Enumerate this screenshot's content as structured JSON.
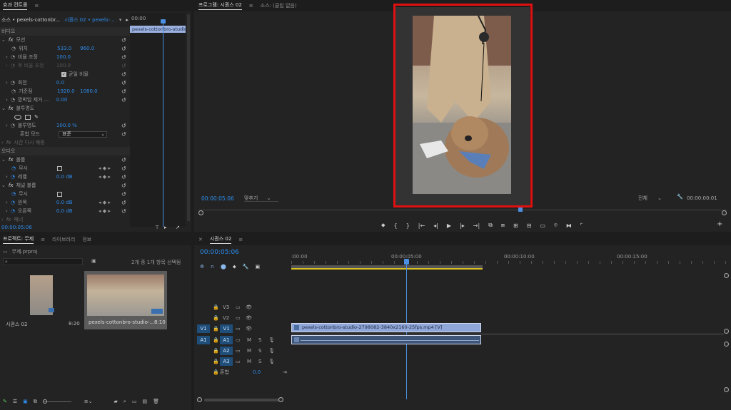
{
  "effect_controls": {
    "tab_label": "효과 컨트롤",
    "source_label": "소스 • pexels-cottonbr...",
    "sequence_label": "시퀀스 02 • pexels-...",
    "mini_time": "00:00",
    "mini_clip_label": "pexels-cottonbro-studio",
    "video_header": "비디오",
    "motion": "모션",
    "position": "위치",
    "position_x": "533.0",
    "position_y": "960.0",
    "scale": "비율 조정",
    "scale_val": "100.0",
    "scale_width": "폭 비율 조정",
    "scale_width_val": "100.0",
    "uniform_scale": "균일 비율",
    "rotation": "회전",
    "rotation_val": "0.0",
    "anchor": "기준점",
    "anchor_x": "1920.0",
    "anchor_y": "1080.0",
    "anti_flicker": "깜박임 제거 ...",
    "anti_flicker_val": "0.00",
    "opacity": "불투명도",
    "opacity_prop": "불투명도",
    "opacity_val": "100.0 %",
    "blend_mode": "혼합 모드",
    "blend_mode_val": "표준",
    "time_remap": "시간 다시 매핑",
    "audio_header": "오디오",
    "volume": "볼륨",
    "bypass": "무시",
    "level": "레벨",
    "level_val": "0.0 dB",
    "channel_volume": "채널 볼륨",
    "bypass2": "무시",
    "left": "왼쪽",
    "left_val": "0.0 dB",
    "right": "오른쪽",
    "right_val": "0.0 dB",
    "panner": "패너",
    "current_time": "00:00:05:06"
  },
  "program_monitor": {
    "tab_program": "프로그램: 시퀀스 02",
    "tab_source": "소스: (클립 없음)",
    "timecode": "00:00:05:06",
    "fit": "맞추기",
    "quality": "전체",
    "duration": "00:00:00:01"
  },
  "project": {
    "tab_project": "프로젝트: 무제",
    "tab_library": "라이브러리",
    "tab_info": "정보",
    "proj_file": "무제.prproj",
    "selection_count": "2개 중 1개 항목 선택됨",
    "item1_name": "시퀀스 02",
    "item1_duration": "8:20",
    "item2_name": "pexels-cottonbro-studio-...",
    "item2_duration": "8:10"
  },
  "timeline": {
    "tab_label": "시퀀스 02",
    "timecode": "00:00:05:06",
    "ruler_0": ":00:00",
    "ruler_1": "00:00:05:00",
    "ruler_2": "00:00:10:00",
    "ruler_3": "00:00:15:00",
    "tracks": {
      "v3": "V3",
      "v2": "V2",
      "v1": "V1",
      "v1_src": "V1",
      "a1": "A1",
      "a1_src": "A1",
      "a2": "A2",
      "a3": "A3",
      "mix": "혼합",
      "mix_val": "0.0",
      "m": "M",
      "s": "S"
    },
    "video_clip": "pexels-cottonbro-studio-2798082-3840x2160-25fps.mp4 [V]"
  }
}
